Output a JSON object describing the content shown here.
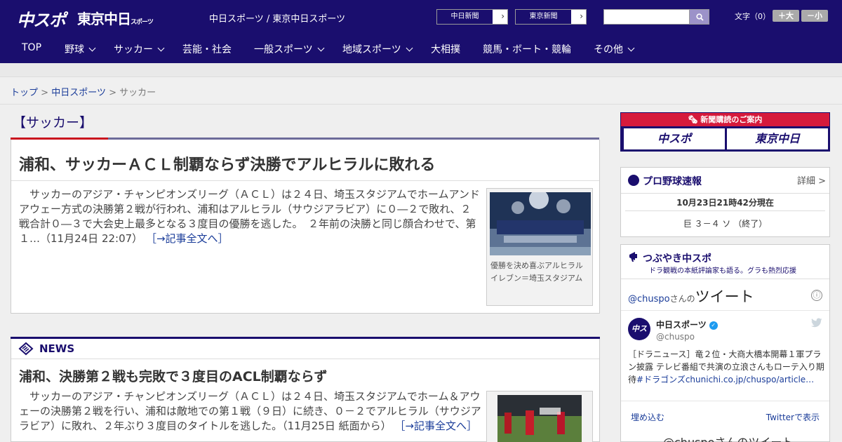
{
  "header": {
    "logo_chuspo": "中スポ",
    "logo_tokyo": "東京中日",
    "logo_tokyo_sub": "スポーツ",
    "site_title": "中日スポーツ / 東京中日スポーツ",
    "paper_links": [
      "中日新聞",
      "東京新聞"
    ],
    "search": {
      "value": "",
      "placeholder": ""
    },
    "font_label": "文字（0）",
    "font_larger": "＋大",
    "font_smaller": "－小"
  },
  "nav": {
    "items": [
      {
        "label": "TOP",
        "has_dropdown": false
      },
      {
        "label": "野球",
        "has_dropdown": true
      },
      {
        "label": "サッカー",
        "has_dropdown": true
      },
      {
        "label": "芸能・社会",
        "has_dropdown": false
      },
      {
        "label": "一般スポーツ",
        "has_dropdown": true
      },
      {
        "label": "地域スポーツ",
        "has_dropdown": true
      },
      {
        "label": "大相撲",
        "has_dropdown": false
      },
      {
        "label": "競馬・ボート・競輪",
        "has_dropdown": false
      },
      {
        "label": "その他",
        "has_dropdown": true
      }
    ]
  },
  "breadcrumb": {
    "items": [
      "トップ",
      "中日スポーツ",
      "サッカー"
    ],
    "separator": ">"
  },
  "main": {
    "section_title": "【サッカー】",
    "top_article": {
      "headline": "浦和、サッカーＡＣＬ制覇ならず決勝でアルヒラルに敗れる",
      "body": "　サッカーのアジア・チャンピオンズリーグ（ＡＣＬ）は２４日、埼玉スタジアムでホームアンドアウェー方式の決勝第２戦が行われ、浦和はアルヒラル（サウジアラビア）に０―２で敗れ、２戦合計０―３で大会史上最多となる３度目の優勝を逃した。　２年前の決勝と同じ顔合わせで、第１…（11月24日 22:07）",
      "read_more": "［→記事全文へ］",
      "photo_caption": "優勝を決め喜ぶアルヒラルイレブン＝埼玉スタジアム"
    },
    "news": {
      "label": "NEWS",
      "headline": "浦和、決勝第２戦も完敗で３度目のACL制覇ならず",
      "body": "　サッカーのアジア・チャンピオンズリーグ（ＡＣＬ）は２４日、埼玉スタジアムでホーム＆アウェーの決勝第２戦を行い、浦和は敵地での第１戦（９日）に続き、０－２でアルヒラル（サウジアラビア）に敗れ、２年ぶり３度目のタイトルを逃した。（11月25日 紙面から）",
      "read_more": "［→記事全文へ］"
    }
  },
  "sidebar": {
    "subscription": {
      "title": "新聞購読のご案内",
      "buttons": [
        "中スポ",
        "東京中日"
      ]
    },
    "baseball": {
      "title": "プロ野球速報",
      "more": "詳細 >",
      "updated": "10月23日21時42分現在",
      "score": "巨 ３－４ ソ （終了）"
    },
    "tweets": {
      "title": "つぶやき中スポ",
      "subtitle": "ドラ観戦の本紙評論家も語る。グラも熱烈応援",
      "handle": "@chuspo",
      "handle_suffix": "さんの",
      "handle_word": "ツイート",
      "info": "ⓘ",
      "tweet_name": "中日スポーツ",
      "tweet_account": "@chuspo",
      "tweet_text": "［ドラニュース］竜２位・大商大橋本開幕１軍プラン披露 テレビ番組で共演の立浪さんもローテ入り期待",
      "tweet_link": "#ドラゴンズchunichi.co.jp/chuspo/article…",
      "embed": "埋め込む",
      "view_on_twitter": "Twitterで表示",
      "footer": "@chuspoさんのツイート"
    }
  },
  "colors": {
    "brand_navy": "#1a0e6e",
    "accent_red": "#c9151e",
    "link_blue": "#1a3c99"
  }
}
